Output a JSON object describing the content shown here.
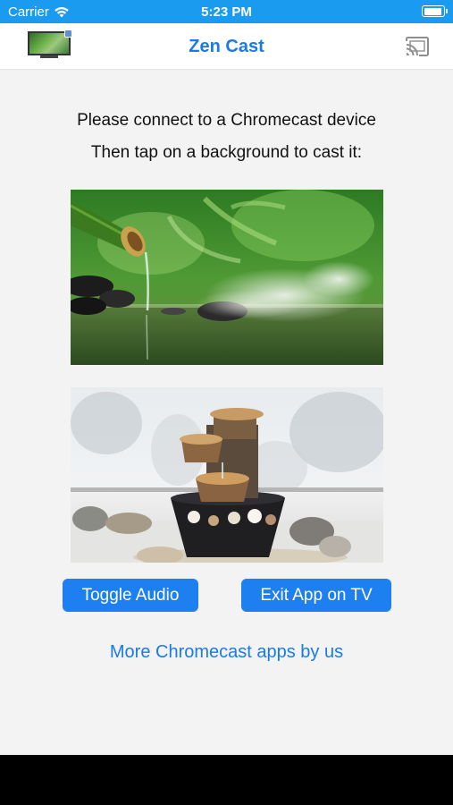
{
  "status_bar": {
    "carrier": "Carrier",
    "time": "5:23 PM",
    "battery_level": 1.0
  },
  "nav": {
    "title": "Zen Cast",
    "left_icon": "tv-thumbnail-icon",
    "right_icon": "chromecast-icon"
  },
  "main": {
    "instruction_line1": "Please connect to a Chromecast device",
    "instruction_line2": "Then tap on a background to cast it:",
    "backgrounds": [
      {
        "icon": "bamboo-water-fountain-image"
      },
      {
        "icon": "tabletop-fountain-window-image"
      }
    ],
    "buttons": {
      "toggle_audio": "Toggle Audio",
      "exit_app": "Exit App on TV"
    },
    "more_link": "More Chromecast apps by us"
  },
  "colors": {
    "status_bar_bg": "#1a9bf0",
    "accent": "#1a7ae8",
    "button_bg": "#1e7ff0",
    "content_bg": "#f3f3f3"
  }
}
